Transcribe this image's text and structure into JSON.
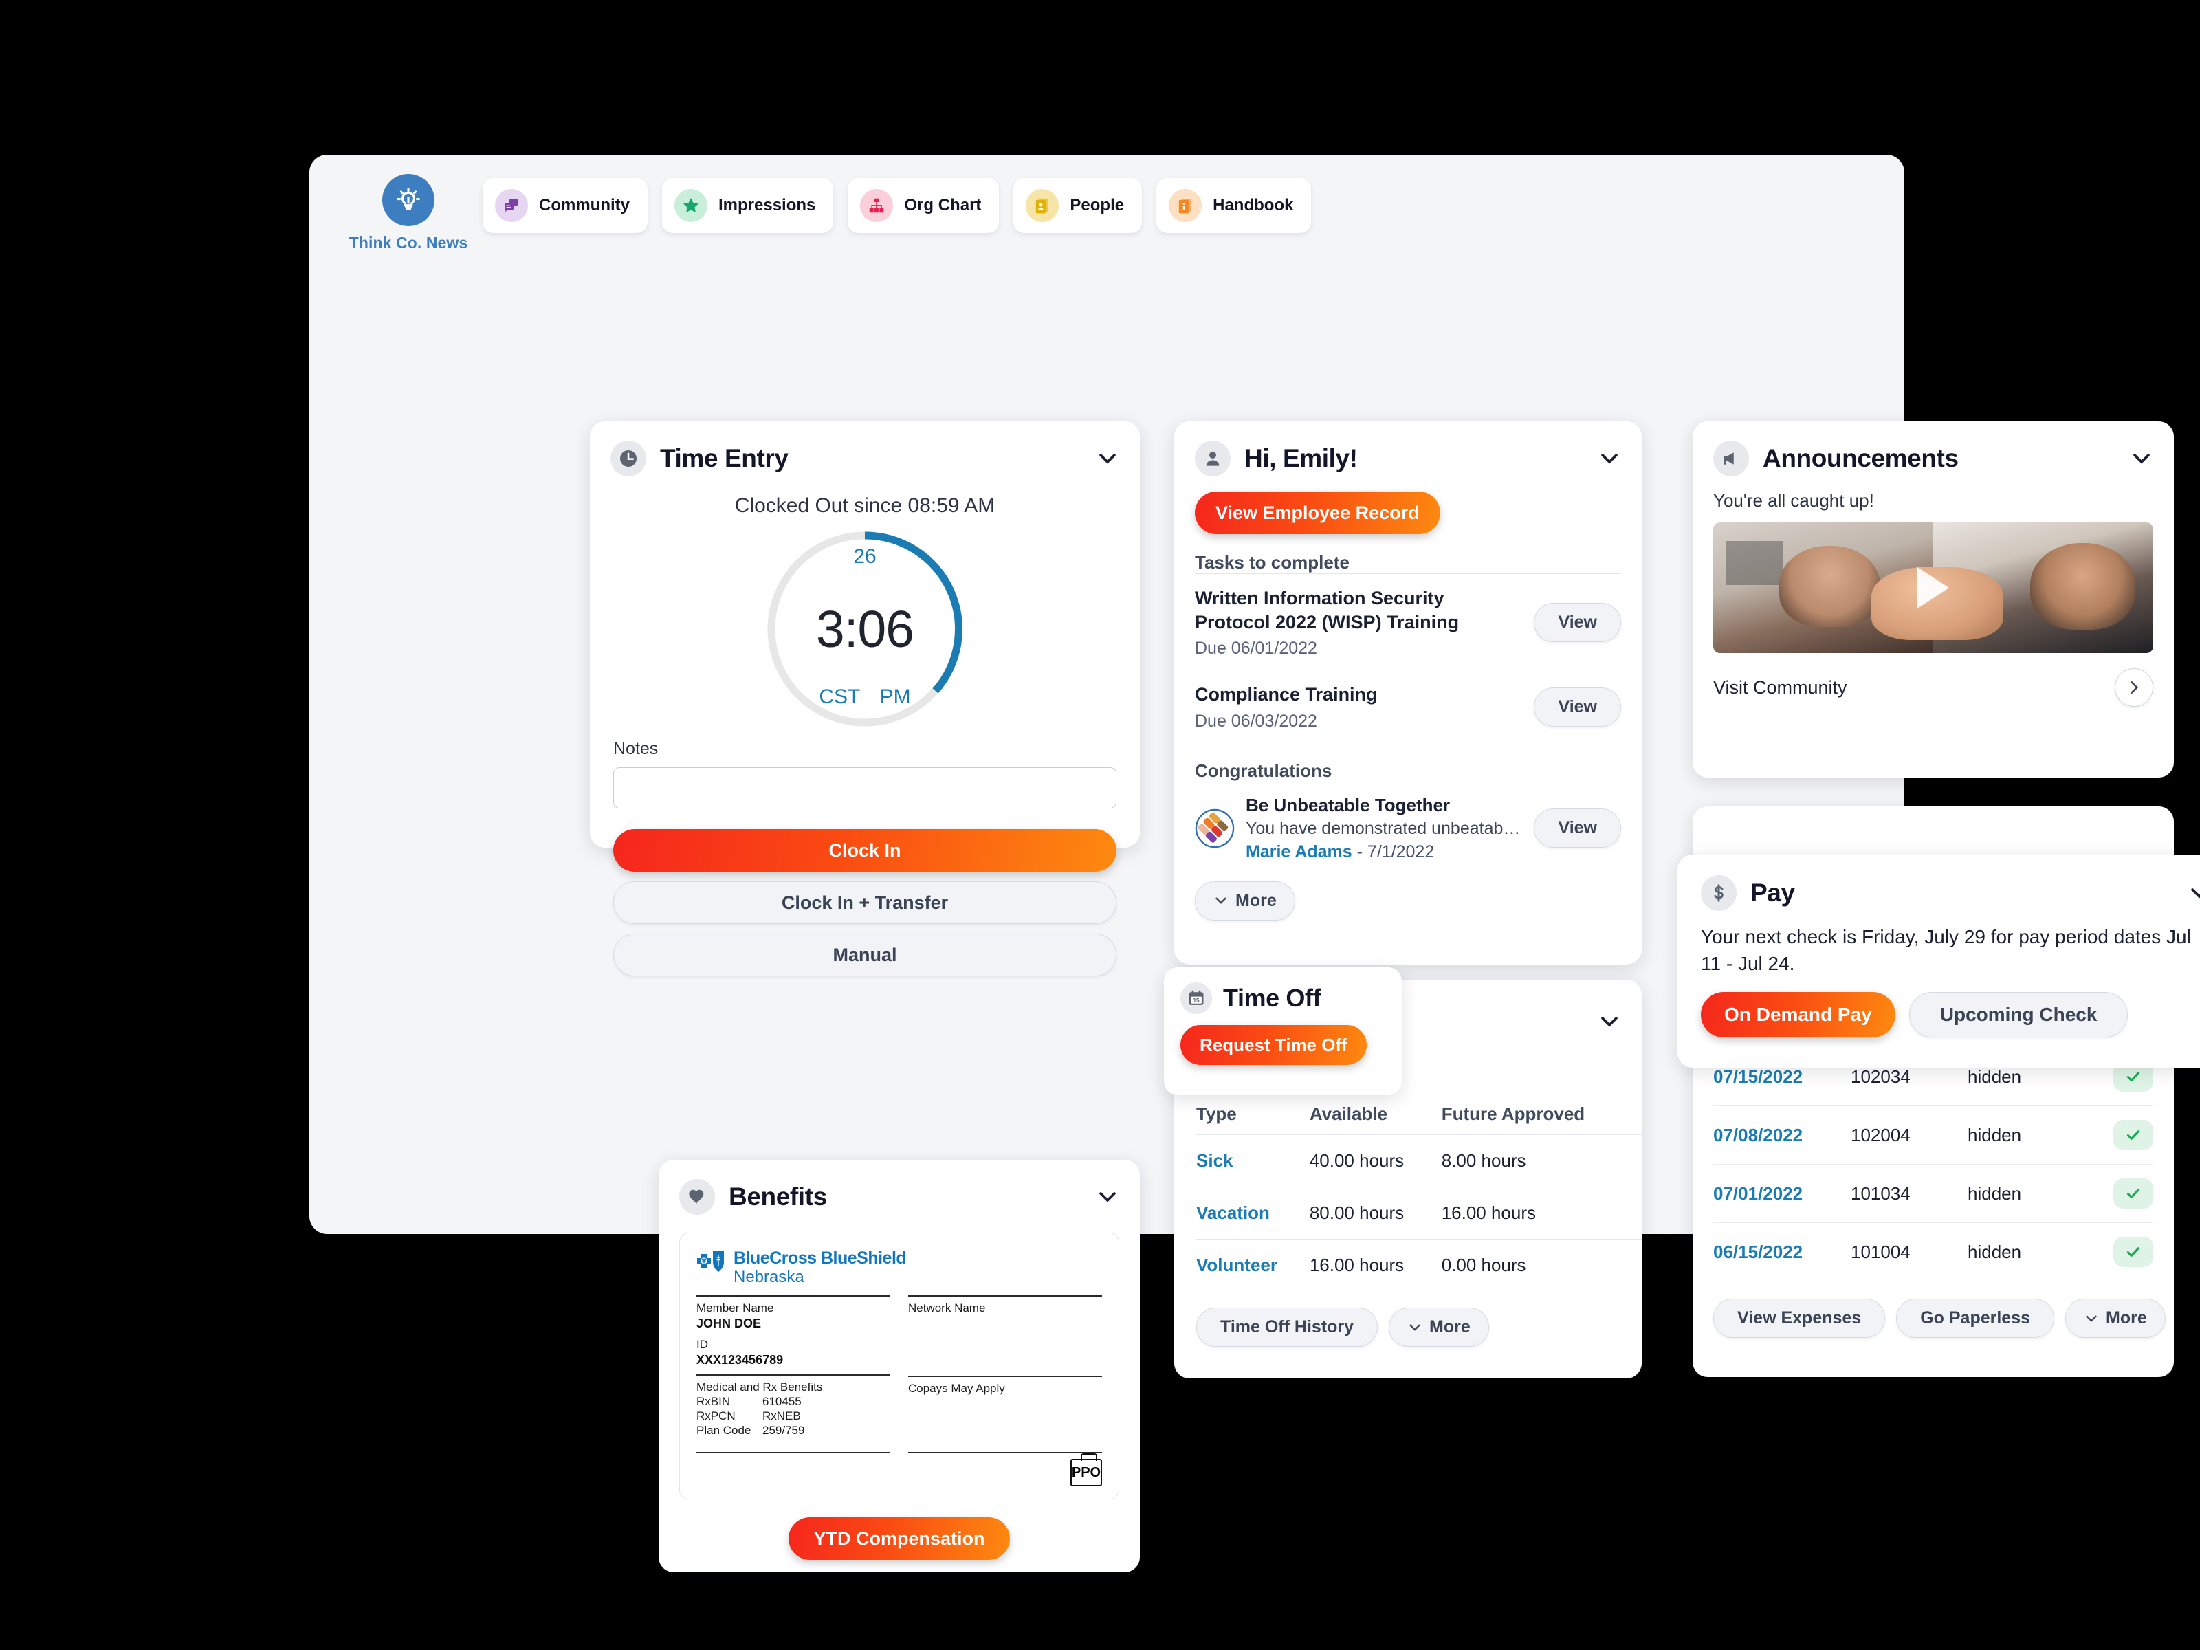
{
  "nav": {
    "brand": {
      "label": "Think Co. News",
      "icon": "lightbulb-icon"
    },
    "items": [
      {
        "label": "Community",
        "icon": "chat-bubbles-icon",
        "bg": "#e6d6f2",
        "fg": "#7b3fa8"
      },
      {
        "label": "Impressions",
        "icon": "star-icon",
        "bg": "#c9efdb",
        "fg": "#14a86a"
      },
      {
        "label": "Org Chart",
        "icon": "org-chart-icon",
        "bg": "#fbcfd9",
        "fg": "#ea1e4e"
      },
      {
        "label": "People",
        "icon": "id-cards-icon",
        "bg": "#f7e5a8",
        "fg": "#e0b100"
      },
      {
        "label": "Handbook",
        "icon": "handbook-icon",
        "bg": "#fde0c2",
        "fg": "#f7881f"
      }
    ]
  },
  "time_entry": {
    "title": "Time Entry",
    "icon": "clock-icon",
    "status": "Clocked Out since 08:59 AM",
    "clock": {
      "day": "26",
      "time": "3:06",
      "timezone": "CST",
      "meridiem": "PM",
      "ring_color": "#1b7cb4",
      "track_color": "#e7e7e7",
      "progress_degrees": 168
    },
    "notes_label": "Notes",
    "notes_value": "",
    "notes_placeholder": "",
    "buttons": {
      "primary": "Clock In",
      "secondary": "Clock In + Transfer",
      "tertiary": "Manual"
    }
  },
  "benefits": {
    "title": "Benefits",
    "icon": "heart-icon",
    "insurance_card": {
      "brand_line1": "BlueCross BlueShield",
      "brand_line2": "Nebraska",
      "member_name_label": "Member Name",
      "member_name_value": "JOHN DOE",
      "id_label": "ID",
      "id_value": "XXX123456789",
      "network_label": "Network Name",
      "network_value": "",
      "benefits_label": "Medical and Rx Benefits",
      "rows": [
        {
          "key": "RxBIN",
          "value": "610455"
        },
        {
          "key": "RxPCN",
          "value": "RxNEB"
        },
        {
          "key": "Plan Code",
          "value": "259/759"
        }
      ],
      "copays_label": "Copays May Apply",
      "plan_mark": "PPO"
    },
    "ytd_button": "YTD Compensation"
  },
  "greeting": {
    "title": "Hi, Emily!",
    "icon": "person-icon",
    "primary_button": "View Employee Record",
    "tasks_heading": "Tasks to complete",
    "tasks": [
      {
        "title": "Written Information Security Protocol 2022 (WISP) Training",
        "due": "Due 06/01/2022",
        "action": "View"
      },
      {
        "title": "Compliance Training",
        "due": "Due 06/03/2022",
        "action": "View"
      }
    ],
    "congrats_heading": "Congratulations",
    "congrats": {
      "icon": "teamwork-hands-icon",
      "title": "Be Unbeatable Together",
      "description": "You have demonstrated unbeatable...",
      "author": "Marie Adams",
      "date": "- 7/1/2022",
      "action": "View"
    },
    "more_button": "More"
  },
  "time_off": {
    "title": "Time Off",
    "icon": "calendar-15-icon",
    "request_button": "Request Time Off",
    "columns": [
      "Type",
      "Available",
      "Future Approved"
    ],
    "rows": [
      {
        "type": "Sick",
        "available": "40.00 hours",
        "future": "8.00 hours"
      },
      {
        "type": "Vacation",
        "available": "80.00 hours",
        "future": "16.00 hours"
      },
      {
        "type": "Volunteer",
        "available": "16.00 hours",
        "future": "0.00 hours"
      }
    ],
    "actions": {
      "history": "Time Off History",
      "more": "More"
    }
  },
  "announcements": {
    "title": "Announcements",
    "icon": "megaphone-icon",
    "caught_up": "You're all caught up!",
    "media": {
      "icon": "play-icon",
      "alt": "video thumbnail of two people waving"
    },
    "link": "Visit Community",
    "next_icon": "chevron-right-icon"
  },
  "pay": {
    "title": "Pay",
    "icon": "dollar-icon",
    "message": "Your next check is Friday, July 29 for pay period dates Jul 11 - Jul 24.",
    "buttons": {
      "primary": "On Demand Pay",
      "secondary": "Upcoming Check"
    },
    "rows": [
      {
        "date": "07/15/2022",
        "number": "102034",
        "amount": "hidden",
        "status": "check-icon"
      },
      {
        "date": "07/08/2022",
        "number": "102004",
        "amount": "hidden",
        "status": "check-icon"
      },
      {
        "date": "07/01/2022",
        "number": "101034",
        "amount": "hidden",
        "status": "check-icon"
      },
      {
        "date": "06/15/2022",
        "number": "101004",
        "amount": "hidden",
        "status": "check-icon"
      }
    ],
    "actions": {
      "expenses": "View Expenses",
      "paperless": "Go Paperless",
      "more": "More"
    }
  },
  "colors": {
    "accent_orange_start": "#f5261d",
    "accent_orange_end": "#fd8a10",
    "brand_blue": "#3c7ebf",
    "link_blue": "#1b7cb4",
    "success_green": "#1aa851",
    "window_bg": "#f4f5f7"
  }
}
